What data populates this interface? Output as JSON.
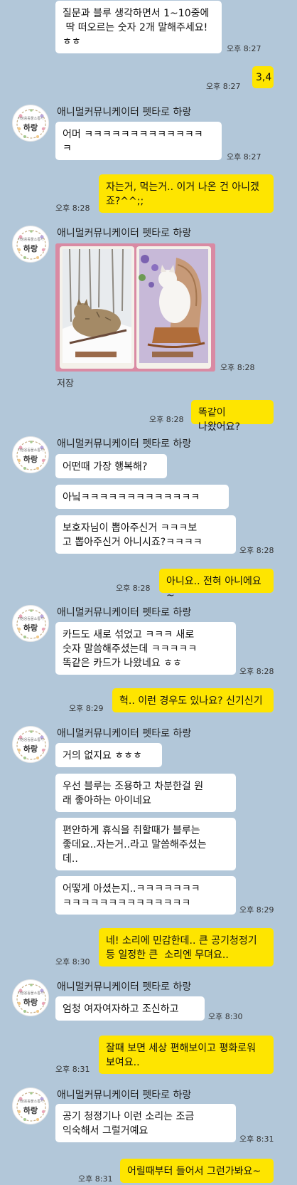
{
  "contact": {
    "name": "애니멀커뮤니케이터 펫타로 하랑",
    "avatar_small_text": "가정용동물소통가",
    "avatar_name": "하랑"
  },
  "photo": {
    "save_label": "저장"
  },
  "messages": {
    "m1": {
      "text": "질문과 블루 생각하면서 1~10중에\n 딱 떠오르는 숫자 2개 말해주세요!\nㅎㅎ",
      "time": "오후 8:27"
    },
    "m2": {
      "text": "3,4",
      "time": "오후 8:27"
    },
    "m3": {
      "text": "어머 ㅋㅋㅋㅋㅋㅋㅋㅋㅋㅋㅋㅋㅋ\nㅋ",
      "time": "오후 8:27"
    },
    "m4": {
      "text": "자는거, 먹는거.. 이거 나온 건 아니겠\n죠?^^;;",
      "time": "오후 8:28"
    },
    "m5": {
      "time": "오후 8:28"
    },
    "m6": {
      "text": "똑같이 나왔어요?",
      "time": "오후 8:28"
    },
    "m7": {
      "text": "어떤때 가장 행복해?"
    },
    "m8": {
      "text": "아닠ㅋㅋㅋㅋㅋㅋㅋㅋㅋㅋㅋㅋㅋ"
    },
    "m9": {
      "text": "보호자님이 뽑아주신거 ㅋㅋㅋ보\n고 뽑아주신거 아니시죠?ㅋㅋㅋㅋ",
      "time": "오후 8:28"
    },
    "m10": {
      "text": "아니요.. 전혀 아니에요~",
      "time": "오후 8:28"
    },
    "m11": {
      "text": "카드도 새로 섞었고 ㅋㅋㅋ 새로\n숫자 말씀해주셨는데 ㅋㅋㅋㅋㅋ\n똑같은 카드가 나왔네요 ㅎㅎ",
      "time": "오후 8:28"
    },
    "m12": {
      "text": "헉.. 이런 경우도 있나요? 신기신기",
      "time": "오후 8:29"
    },
    "m13": {
      "text": "거의 없지요 ㅎㅎㅎ"
    },
    "m14": {
      "text": "우선 블루는 조용하고 차분한걸 원\n래 좋아하는 아이네요"
    },
    "m15": {
      "text": "편안하게 휴식을 취할때가 블루는\n좋데요..자는거..라고 말씀해주셨는\n데.."
    },
    "m16": {
      "text": "어떻게 아셨는지..ㅋㅋㅋㅋㅋㅋㅋ\nㅋㅋㅋㅋㅋㅋㅋㅋㅋㅋㅋㅋㅋㅋ",
      "time": "오후 8:29"
    },
    "m17": {
      "text": "네! 소리에 민감한데.. 큰 공기청정기\n등 일정한 큰  소리엔 무뎌요..",
      "time": "오후 8:30"
    },
    "m18": {
      "text": "엄청 여자여자하고 조신하고",
      "time": "오후 8:30"
    },
    "m19": {
      "text": "잘때 보면 세상 편해보이고 평화로워\n보여요..",
      "time": "오후 8:31"
    },
    "m20": {
      "text": "공기 청정기나 이런 소리는 조금\n익숙해서 그럴거예요",
      "time": "오후 8:31"
    },
    "m21": {
      "text": "어릴때부터 들어서 그런가봐요~",
      "time": "오후 8:31"
    }
  },
  "colors": {
    "background": "#b2c7d9",
    "my_bubble": "#fee500",
    "their_bubble": "#ffffff"
  }
}
